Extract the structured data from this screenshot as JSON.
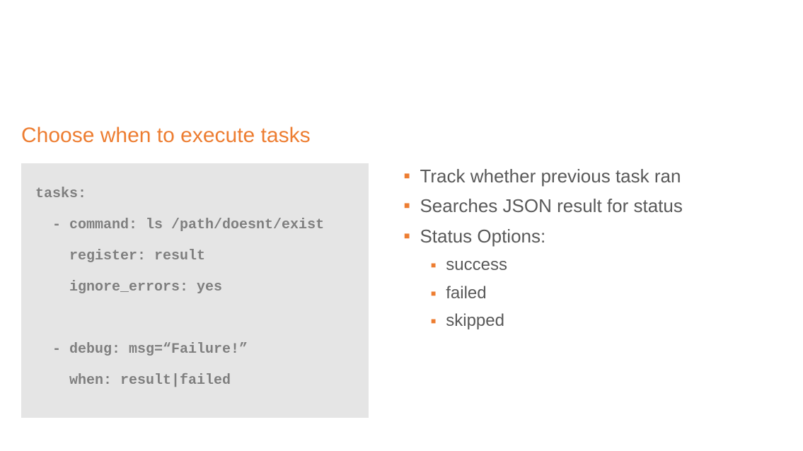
{
  "heading": "Choose when to execute tasks",
  "code": "tasks:\n  - command: ls /path/doesnt/exist\n    register: result\n    ignore_errors: yes\n\n  - debug: msg=“Failure!”\n    when: result|failed",
  "bullets": {
    "item1": "Track whether previous task ran",
    "item2": "Searches JSON result for status",
    "item3": "Status Options:",
    "sub1": "success",
    "sub2": "failed",
    "sub3": "skipped"
  }
}
